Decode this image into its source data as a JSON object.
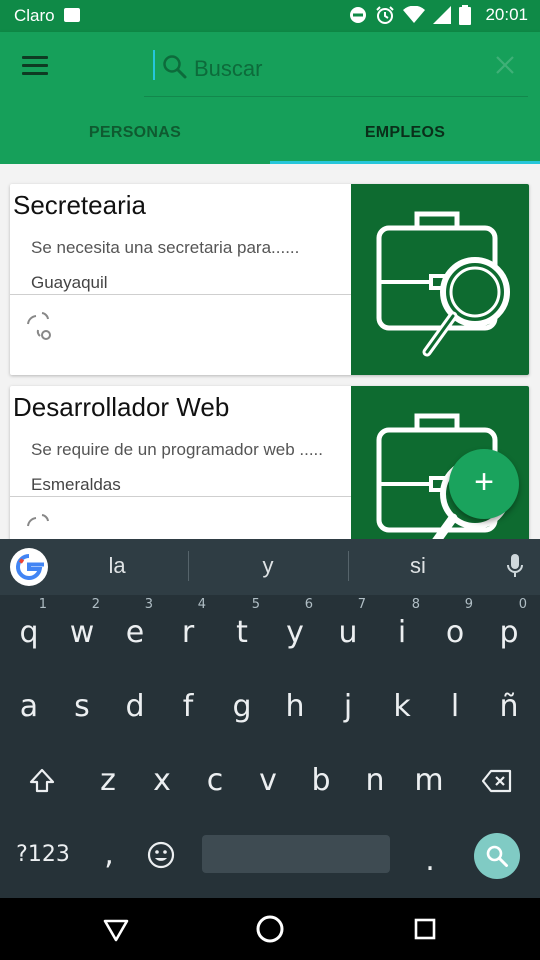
{
  "status_bar": {
    "carrier": "Claro",
    "time": "20:01"
  },
  "search": {
    "placeholder": "Buscar"
  },
  "tabs": [
    {
      "label": "PERSONAS",
      "active": false
    },
    {
      "label": "EMPLEOS",
      "active": true
    }
  ],
  "jobs": [
    {
      "title": "Secretearia",
      "description": "Se necesita una secretaria para......",
      "city": "Guayaquil"
    },
    {
      "title": "Desarrollador Web",
      "description": "Se require de un programador web .....",
      "city": "Esmeraldas"
    }
  ],
  "fab": {
    "label": "+"
  },
  "keyboard": {
    "suggestions": [
      "la",
      "y",
      "si"
    ],
    "row1": [
      {
        "key": "q",
        "hint": "1"
      },
      {
        "key": "w",
        "hint": "2"
      },
      {
        "key": "e",
        "hint": "3"
      },
      {
        "key": "r",
        "hint": "4"
      },
      {
        "key": "t",
        "hint": "5"
      },
      {
        "key": "y",
        "hint": "6"
      },
      {
        "key": "u",
        "hint": "7"
      },
      {
        "key": "i",
        "hint": "8"
      },
      {
        "key": "o",
        "hint": "9"
      },
      {
        "key": "p",
        "hint": "0"
      }
    ],
    "row2": [
      "a",
      "s",
      "d",
      "f",
      "g",
      "h",
      "j",
      "k",
      "l",
      "ñ"
    ],
    "row3": [
      "z",
      "x",
      "c",
      "v",
      "b",
      "n",
      "m"
    ],
    "symbols_label": "?123",
    "comma": ",",
    "period": "."
  },
  "colors": {
    "status_bar": "#0f8a47",
    "app_bar": "#16a05a",
    "tab_indicator": "#26c6da",
    "card_thumb": "#0e6b30",
    "fab": "#1aa35d",
    "keyboard_bg": "#263238",
    "search_key": "#80cbc4"
  },
  "icons": [
    "image-icon",
    "dnd-icon",
    "alarm-icon",
    "wifi-icon",
    "signal-icon",
    "battery-icon",
    "menu-icon",
    "search-icon",
    "close-icon",
    "briefcase-search-icon",
    "loading-icon",
    "google-icon",
    "mic-icon",
    "shift-icon",
    "backspace-icon",
    "emoji-icon",
    "back-icon",
    "home-icon",
    "recents-icon"
  ]
}
